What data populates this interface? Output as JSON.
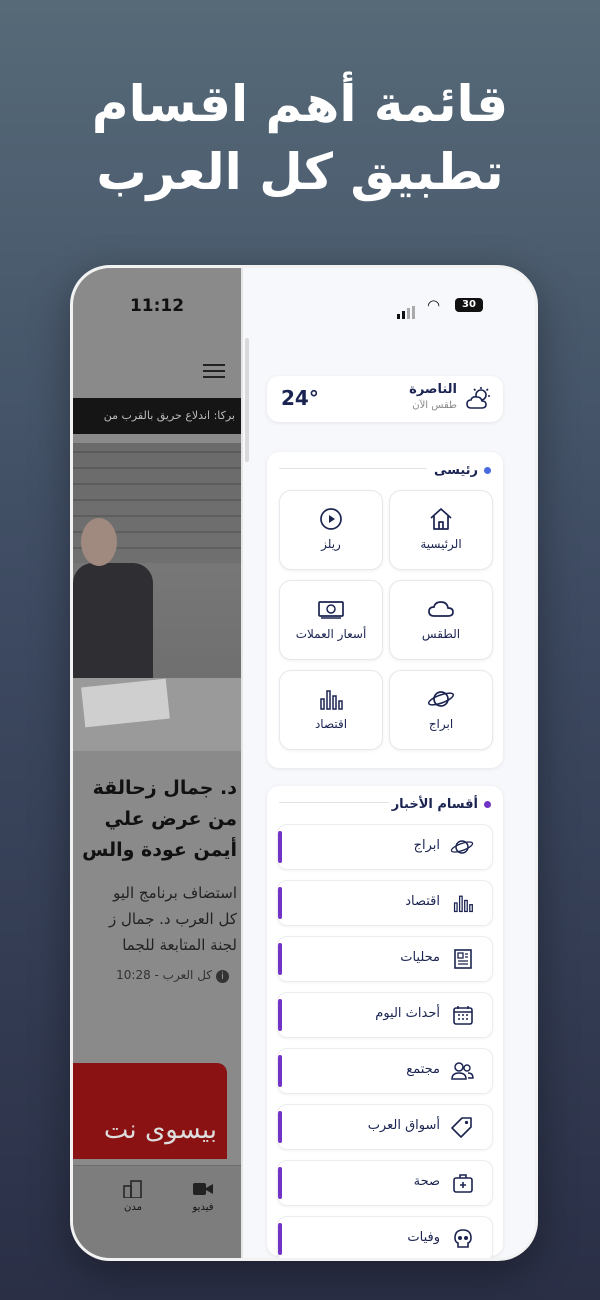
{
  "headline": {
    "line1": "قائمة أهم اقسام",
    "line2": "تطبيق كل العرب"
  },
  "background_app": {
    "time": "11:12",
    "ticker": "بركا: اندلاع حريق بالقرب من",
    "news_title_lines": [
      "د. جمال زحالقة",
      "من عرض علي",
      "أيمن عودة والس"
    ],
    "news_body_lines": [
      "استضاف برنامج اليو",
      "كل العرب د. جمال ز",
      "لجنة المتابعة للجما"
    ],
    "news_meta": "كل العرب - 10:28",
    "promo_text": "بيسوى نت",
    "tabs": {
      "video": "فيديو",
      "cities": "مدن"
    }
  },
  "status_bar": {
    "battery": "30"
  },
  "weather": {
    "temp": "24°",
    "city": "الناصرة",
    "subtitle": "طقس الآن"
  },
  "main_section": {
    "title": "رئيسى",
    "dot_color": "#4a6ae0",
    "tiles": [
      {
        "label": "الرئيسية",
        "icon": "home-icon"
      },
      {
        "label": "ريلز",
        "icon": "play-icon"
      },
      {
        "label": "الطقس",
        "icon": "cloud-icon"
      },
      {
        "label": "أسعار العملات",
        "icon": "banknote-icon"
      },
      {
        "label": "ابراج",
        "icon": "planet-icon"
      },
      {
        "label": "اقتصاد",
        "icon": "bar-chart-icon"
      }
    ]
  },
  "news_section": {
    "title": "أقسام الأخبار",
    "dot_color": "#7033c6",
    "items": [
      {
        "label": "ابراج",
        "icon": "planet-icon"
      },
      {
        "label": "اقتصاد",
        "icon": "bar-chart-icon"
      },
      {
        "label": "محليات",
        "icon": "newspaper-icon"
      },
      {
        "label": "أحداث اليوم",
        "icon": "calendar-icon"
      },
      {
        "label": "مجتمع",
        "icon": "people-icon"
      },
      {
        "label": "أسواق العرب",
        "icon": "tag-icon"
      },
      {
        "label": "صحة",
        "icon": "medkit-icon"
      },
      {
        "label": "وفيات",
        "icon": "skull-icon"
      }
    ]
  }
}
